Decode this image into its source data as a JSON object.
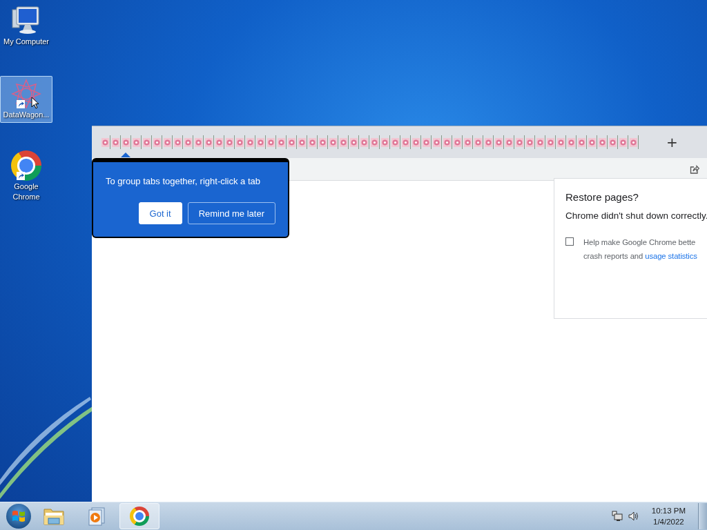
{
  "desktop_icons": [
    {
      "label": "My Computer",
      "kind": "computer",
      "selected": false,
      "shortcut": false
    },
    {
      "label": "DataWagon...",
      "kind": "datawagon",
      "selected": true,
      "shortcut": true
    },
    {
      "label": "Google Chrome",
      "kind": "chrome",
      "selected": false,
      "shortcut": true
    }
  ],
  "browser": {
    "tabs": [
      {
        "selected": false
      },
      {
        "selected": false
      },
      {
        "selected": false
      },
      {
        "selected": false
      },
      {
        "selected": false
      },
      {
        "selected": false
      },
      {
        "selected": false
      },
      {
        "selected": false
      },
      {
        "selected": false
      },
      {
        "selected": false
      },
      {
        "selected": false
      },
      {
        "selected": false
      },
      {
        "selected": false
      },
      {
        "selected": false
      },
      {
        "selected": false
      },
      {
        "selected": false
      },
      {
        "selected": false
      },
      {
        "selected": false
      },
      {
        "selected": false
      },
      {
        "selected": false
      },
      {
        "selected": false
      },
      {
        "selected": false
      },
      {
        "selected": false
      },
      {
        "selected": false
      },
      {
        "selected": false
      },
      {
        "selected": false
      },
      {
        "selected": false
      },
      {
        "selected": false
      },
      {
        "selected": false
      },
      {
        "selected": false
      },
      {
        "selected": false
      },
      {
        "selected": false
      },
      {
        "selected": false
      },
      {
        "selected": false
      },
      {
        "selected": false
      },
      {
        "selected": false
      },
      {
        "selected": false
      },
      {
        "selected": false
      },
      {
        "selected": false
      },
      {
        "selected": false
      },
      {
        "selected": false
      },
      {
        "selected": false
      },
      {
        "selected": false
      },
      {
        "selected": false
      },
      {
        "selected": false
      },
      {
        "selected": false
      },
      {
        "selected": false
      },
      {
        "selected": false
      },
      {
        "selected": false
      },
      {
        "selected": false
      },
      {
        "selected": false
      },
      {
        "selected": false
      }
    ],
    "new_tab_button": "+",
    "tab_tip": {
      "text": "To group tabs together, right-click a tab",
      "buttons": [
        {
          "label": "Got it",
          "kind": "primary"
        },
        {
          "label": "Remind me later",
          "kind": "secondary"
        }
      ]
    },
    "restore_dialog": {
      "title": "Restore pages?",
      "message": "Chrome didn't shut down correctly.",
      "consent": {
        "checked": false,
        "text": "Help make Google Chrome bette",
        "text_2": "crash reports and",
        "link": "usage statistics"
      }
    }
  },
  "taskbar": {
    "apps": [
      {
        "kind": "explorer",
        "active": false
      },
      {
        "kind": "media",
        "active": false
      },
      {
        "kind": "chrome",
        "active": true
      }
    ],
    "clock": {
      "time": "10:13 PM",
      "date": "1/4/2022"
    }
  }
}
